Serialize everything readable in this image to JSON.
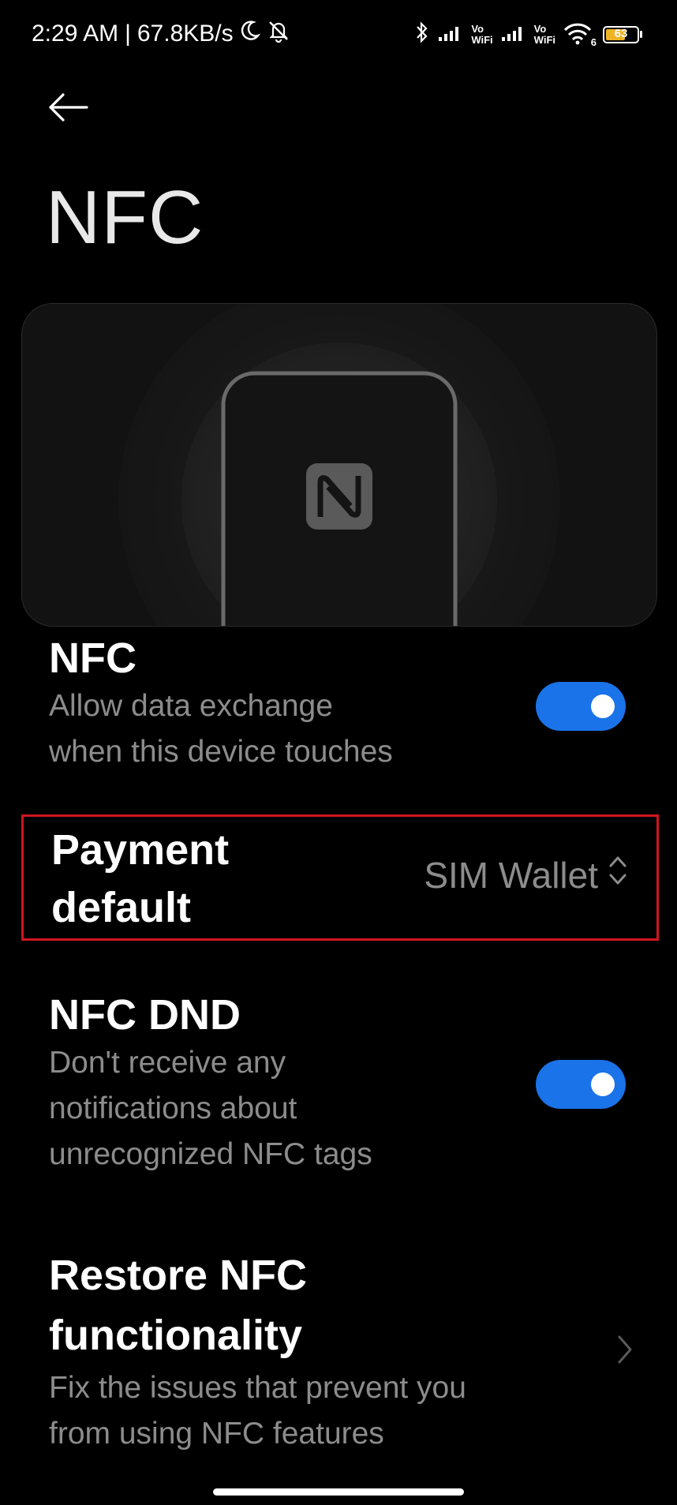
{
  "status_bar": {
    "time": "2:29 AM",
    "separator": "|",
    "network_speed": "67.8KB/s",
    "vowifi_top": "Vo",
    "vowifi_bottom": "WiFi",
    "wifi_label": "6",
    "battery_level": "63",
    "battery_fraction": 0.63,
    "battery_color": "#f0b323"
  },
  "header": {
    "back_icon": "arrow-left-icon",
    "title": "NFC"
  },
  "illustration": {
    "icon": "nfc-n-mark-icon"
  },
  "settings": {
    "nfc": {
      "title": "NFC",
      "description_line1": "Allow data exchange",
      "description_line2": "when this device touches",
      "enabled": true
    },
    "payment_default": {
      "title_line1": "Payment",
      "title_line2": "default",
      "value": "SIM Wallet",
      "icon": "updown-chevron-icon"
    },
    "nfc_dnd": {
      "title": "NFC DND",
      "description_line1": "Don't receive any",
      "description_line2": "notifications about",
      "description_line3": "unrecognized NFC tags",
      "enabled": true
    },
    "restore": {
      "title_line1": "Restore NFC",
      "title_line2": "functionality",
      "description_line1": "Fix the issues that prevent you",
      "description_line2": "from using NFC features",
      "icon": "chevron-right-icon"
    }
  },
  "colors": {
    "background": "#000000",
    "accent": "#1a73e8",
    "highlight_border": "#d0141e",
    "secondary_text": "#8c8c8c"
  }
}
